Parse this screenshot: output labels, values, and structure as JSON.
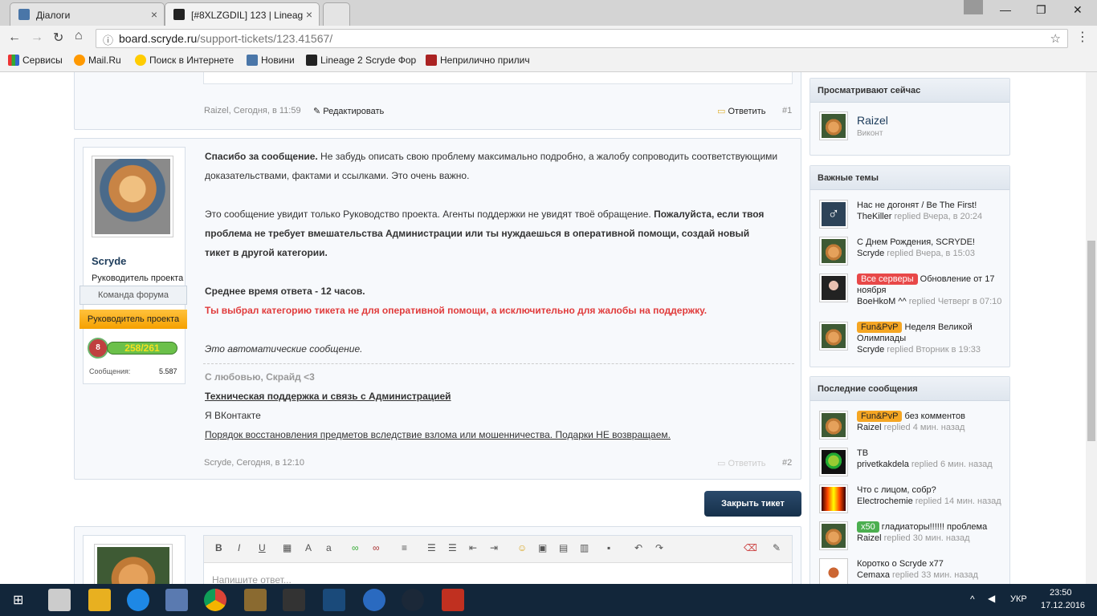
{
  "tabs": [
    {
      "title": "Діалоги"
    },
    {
      "title": "[#8XLZGDIL] 123 | Lineag"
    }
  ],
  "address": {
    "host": "board.scryde.ru",
    "path": "/support-tickets/123.41567/"
  },
  "bookmarks": [
    "Сервисы",
    "Mail.Ru",
    "Поиск в Интернете",
    "Новини",
    "Lineage 2 Scryde Фор",
    "Неприлично прилич"
  ],
  "post1": {
    "author": "Raizel",
    "time": ", Сегодня, в 11:59",
    "edit": "Редактировать",
    "reply": "Ответить",
    "num": "#1"
  },
  "post2": {
    "author": "Scryde",
    "title": "Руководитель проекта",
    "badge_team": "Команда форума",
    "badge_role": "Руководитель проекта",
    "level": "8",
    "xp": "258/261",
    "messages_label": "Сообщения:",
    "messages_value": "5.587",
    "p1_bold": "Спасибо за сообщение.",
    "p1_rest": " Не забудь описать свою проблему максимально подробно, а жалобу сопроводить соответствующими",
    "p1_line2": "доказательствами, фактами и ссылками. Это очень важно.",
    "p2_line1_a": "Это сообщение увидит только Руководство проекта. Агенты поддержки не увидят твоё обращение.",
    "p2_line1_b": " Пожалуйста, если твоя",
    "p2_line2": "проблема не требует вмешательства Администрации или ты нуждаешься в оперативной помощи, создай новый",
    "p2_line3": "тикет в другой категории.",
    "avg": "Среднее время ответа - 12 часов.",
    "warn": "Ты выбрал категорию тикета не для оперативной помощи, а исключительно для жалобы на поддержку.",
    "auto": "Это автоматические сообщение.",
    "sig1": "С любовью, Скрайд <3",
    "sig2": "Техническая поддержка и связь с Администрацией",
    "sig3": "Я ВКонтакте",
    "sig4": "Порядок восстановления предметов вследствие взлома или мошенничества. Подарки НЕ возвращаем.",
    "time": "Scryde, Сегодня, в 12:10",
    "reply": "Ответить",
    "num": "#2"
  },
  "close_button": "Закрыть тикет",
  "editor_placeholder": "Напишите ответ...",
  "sidebar": {
    "viewing": {
      "title": "Просматривают сейчас",
      "user": "Raizel",
      "rank": "Виконт"
    },
    "important": {
      "title": "Важные темы",
      "items": [
        {
          "tag": "",
          "title": "Нас не догонят / Be The First!",
          "user": "TheKiller",
          "rep": " replied Вчера, в 20:24"
        },
        {
          "tag": "",
          "title": "С Днем Рождения, SCRYDE!",
          "user": "Scryde",
          "rep": " replied Вчера, в 15:03"
        },
        {
          "tag": "Все серверы",
          "title": " Обновление от 17 ноября",
          "user": "BoeHkoM ^^",
          "rep": " replied Четверг в 07:10"
        },
        {
          "tag": "Fun&PvP",
          "title": " Неделя Великой Олимпиады",
          "user": "Scryde",
          "rep": " replied Вторник в 19:33"
        }
      ]
    },
    "latest": {
      "title": "Последние сообщения",
      "items": [
        {
          "tag": "Fun&PvP",
          "title": " без комментов",
          "user": "Raizel",
          "rep": " replied 4 мин. назад"
        },
        {
          "tag": "",
          "title": "ТВ",
          "user": "privetkakdela",
          "rep": " replied 6 мин. назад"
        },
        {
          "tag": "",
          "title": "Что с лицом, собр?",
          "user": "Electrochemie",
          "rep": " replied 14 мин. назад"
        },
        {
          "tag": "x50",
          "title": " гладиаторы!!!!!! проблема",
          "user": "Raizel",
          "rep": " replied 30 мин. назад"
        },
        {
          "tag": "",
          "title": "Коротко о Scryde x77",
          "user": "Cemaxa",
          "rep": " replied 33 мин. назад"
        }
      ]
    }
  },
  "taskbar": {
    "lang": "УКР",
    "time": "23:50",
    "date": "17.12.2016"
  },
  "colors": {
    "accent": "#1c3b5a",
    "red": "#e03b3b",
    "tag_red": "#e84848",
    "tag_orange": "#f5a623",
    "tag_green": "#4caf50"
  }
}
